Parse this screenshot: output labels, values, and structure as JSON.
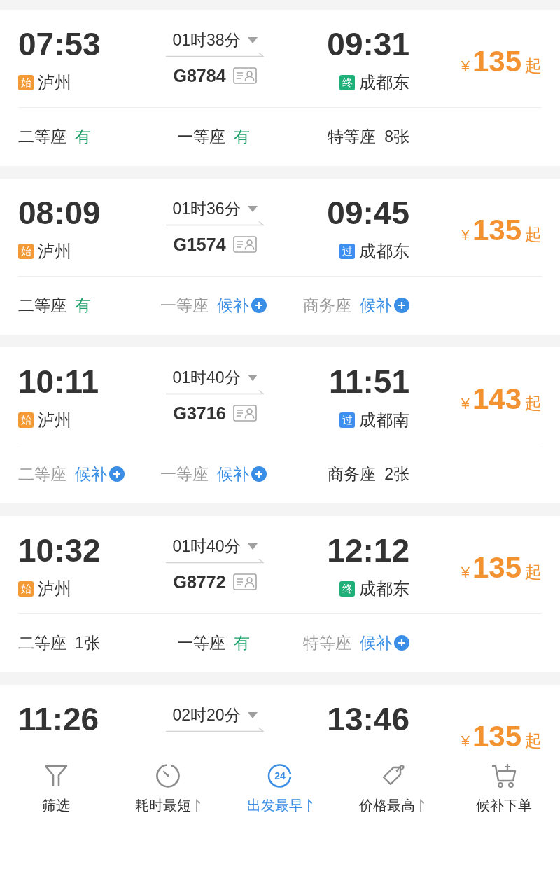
{
  "trains": [
    {
      "depart_time": "07:53",
      "depart_badge": {
        "text": "始",
        "color": "#f39a36"
      },
      "depart_station": "泸州",
      "duration": "01时38分",
      "train_no": "G8784",
      "arrive_time": "09:31",
      "arrive_badge": {
        "text": "终",
        "color": "#1fb07a"
      },
      "arrive_station": "成都东",
      "price": {
        "currency": "¥",
        "amount": "135",
        "suffix": "起"
      },
      "seats": [
        {
          "name": "二等座",
          "status": "有",
          "kind": "available"
        },
        {
          "name": "一等座",
          "status": "有",
          "kind": "available"
        },
        {
          "name": "特等座",
          "status": "8张",
          "kind": "count"
        }
      ]
    },
    {
      "depart_time": "08:09",
      "depart_badge": {
        "text": "始",
        "color": "#f39a36"
      },
      "depart_station": "泸州",
      "duration": "01时36分",
      "train_no": "G1574",
      "arrive_time": "09:45",
      "arrive_badge": {
        "text": "过",
        "color": "#3d8ff0"
      },
      "arrive_station": "成都东",
      "price": {
        "currency": "¥",
        "amount": "135",
        "suffix": "起"
      },
      "seats": [
        {
          "name": "二等座",
          "status": "有",
          "kind": "available"
        },
        {
          "name": "一等座",
          "status": "候补",
          "kind": "waitlist"
        },
        {
          "name": "商务座",
          "status": "候补",
          "kind": "waitlist"
        }
      ]
    },
    {
      "depart_time": "10:11",
      "depart_badge": {
        "text": "始",
        "color": "#f39a36"
      },
      "depart_station": "泸州",
      "duration": "01时40分",
      "train_no": "G3716",
      "arrive_time": "11:51",
      "arrive_badge": {
        "text": "过",
        "color": "#3d8ff0"
      },
      "arrive_station": "成都南",
      "price": {
        "currency": "¥",
        "amount": "143",
        "suffix": "起"
      },
      "seats": [
        {
          "name": "二等座",
          "status": "候补",
          "kind": "waitlist"
        },
        {
          "name": "一等座",
          "status": "候补",
          "kind": "waitlist"
        },
        {
          "name": "商务座",
          "status": "2张",
          "kind": "count"
        }
      ]
    },
    {
      "depart_time": "10:32",
      "depart_badge": {
        "text": "始",
        "color": "#f39a36"
      },
      "depart_station": "泸州",
      "duration": "01时40分",
      "train_no": "G8772",
      "arrive_time": "12:12",
      "arrive_badge": {
        "text": "终",
        "color": "#1fb07a"
      },
      "arrive_station": "成都东",
      "price": {
        "currency": "¥",
        "amount": "135",
        "suffix": "起"
      },
      "seats": [
        {
          "name": "二等座",
          "status": "1张",
          "kind": "count"
        },
        {
          "name": "一等座",
          "status": "有",
          "kind": "available"
        },
        {
          "name": "特等座",
          "status": "候补",
          "kind": "waitlist"
        }
      ]
    },
    {
      "depart_time": "11:26",
      "duration": "02时20分",
      "arrive_time": "13:46",
      "price": {
        "currency": "¥",
        "amount": "135",
        "suffix": "起"
      }
    }
  ],
  "bottom_nav": [
    {
      "label": "筛选",
      "kind": "filter",
      "selected": false
    },
    {
      "label": "耗时最短",
      "kind": "sort",
      "selected": false
    },
    {
      "label": "出发最早",
      "kind": "sort",
      "selected": true,
      "icon_text": "24"
    },
    {
      "label": "价格最高",
      "kind": "sort",
      "selected": false
    },
    {
      "label": "候补下单",
      "kind": "action",
      "selected": false
    }
  ]
}
